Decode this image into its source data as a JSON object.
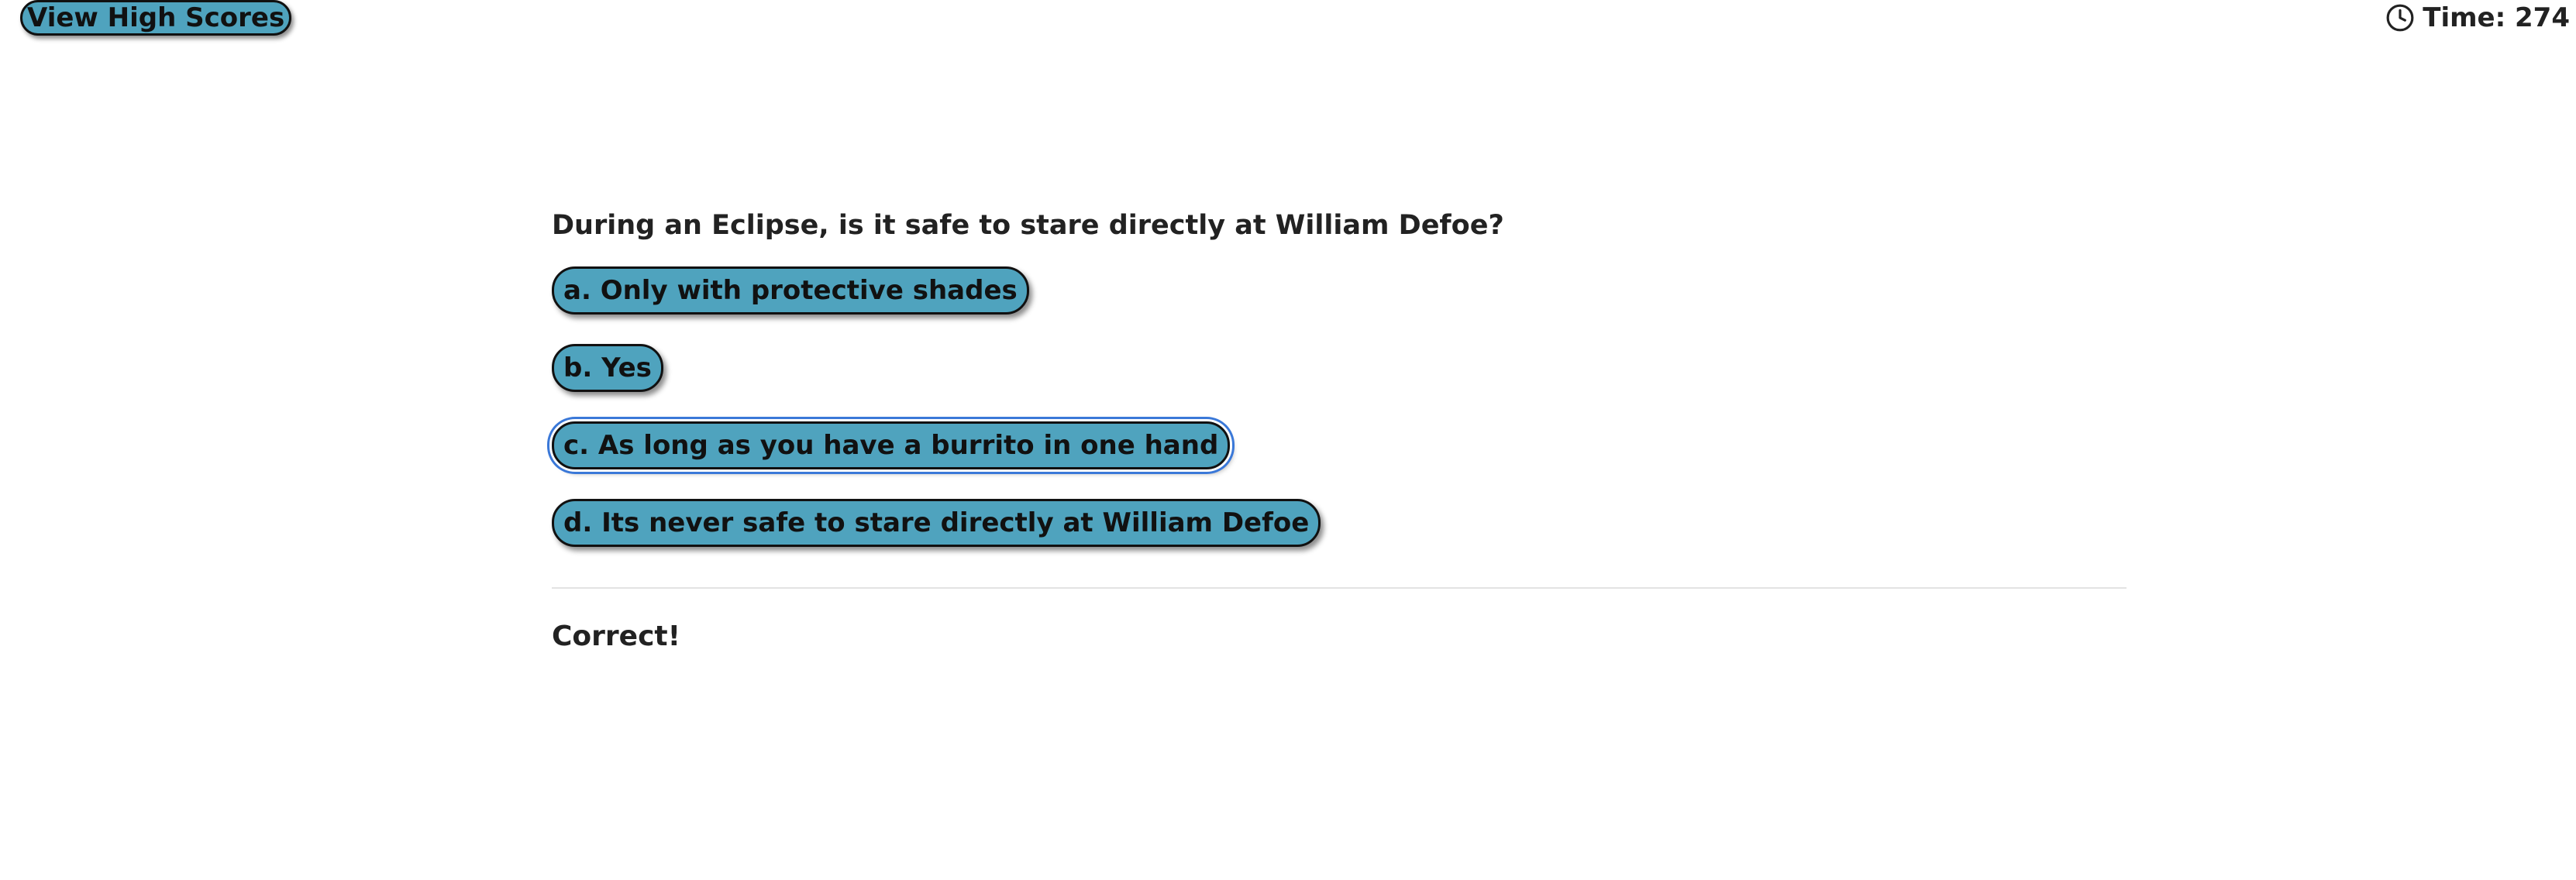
{
  "header": {
    "high_scores_label": "View High Scores",
    "timer_icon": "clock-icon",
    "timer_label": "Time: 274"
  },
  "quiz": {
    "question": "During an Eclipse, is it safe to stare directly at William Defoe?",
    "choices": [
      {
        "label": "a. Only with protective shades"
      },
      {
        "label": "b. Yes"
      },
      {
        "label": "c. As long as you have a burrito in one hand"
      },
      {
        "label": "d. Its never safe to stare directly at William Defoe"
      }
    ],
    "selected_index": 2,
    "feedback": "Correct!"
  },
  "colors": {
    "button_fill": "#4fa3be",
    "button_border": "#111111",
    "focus_ring": "#3a78d8",
    "text": "#222222"
  }
}
